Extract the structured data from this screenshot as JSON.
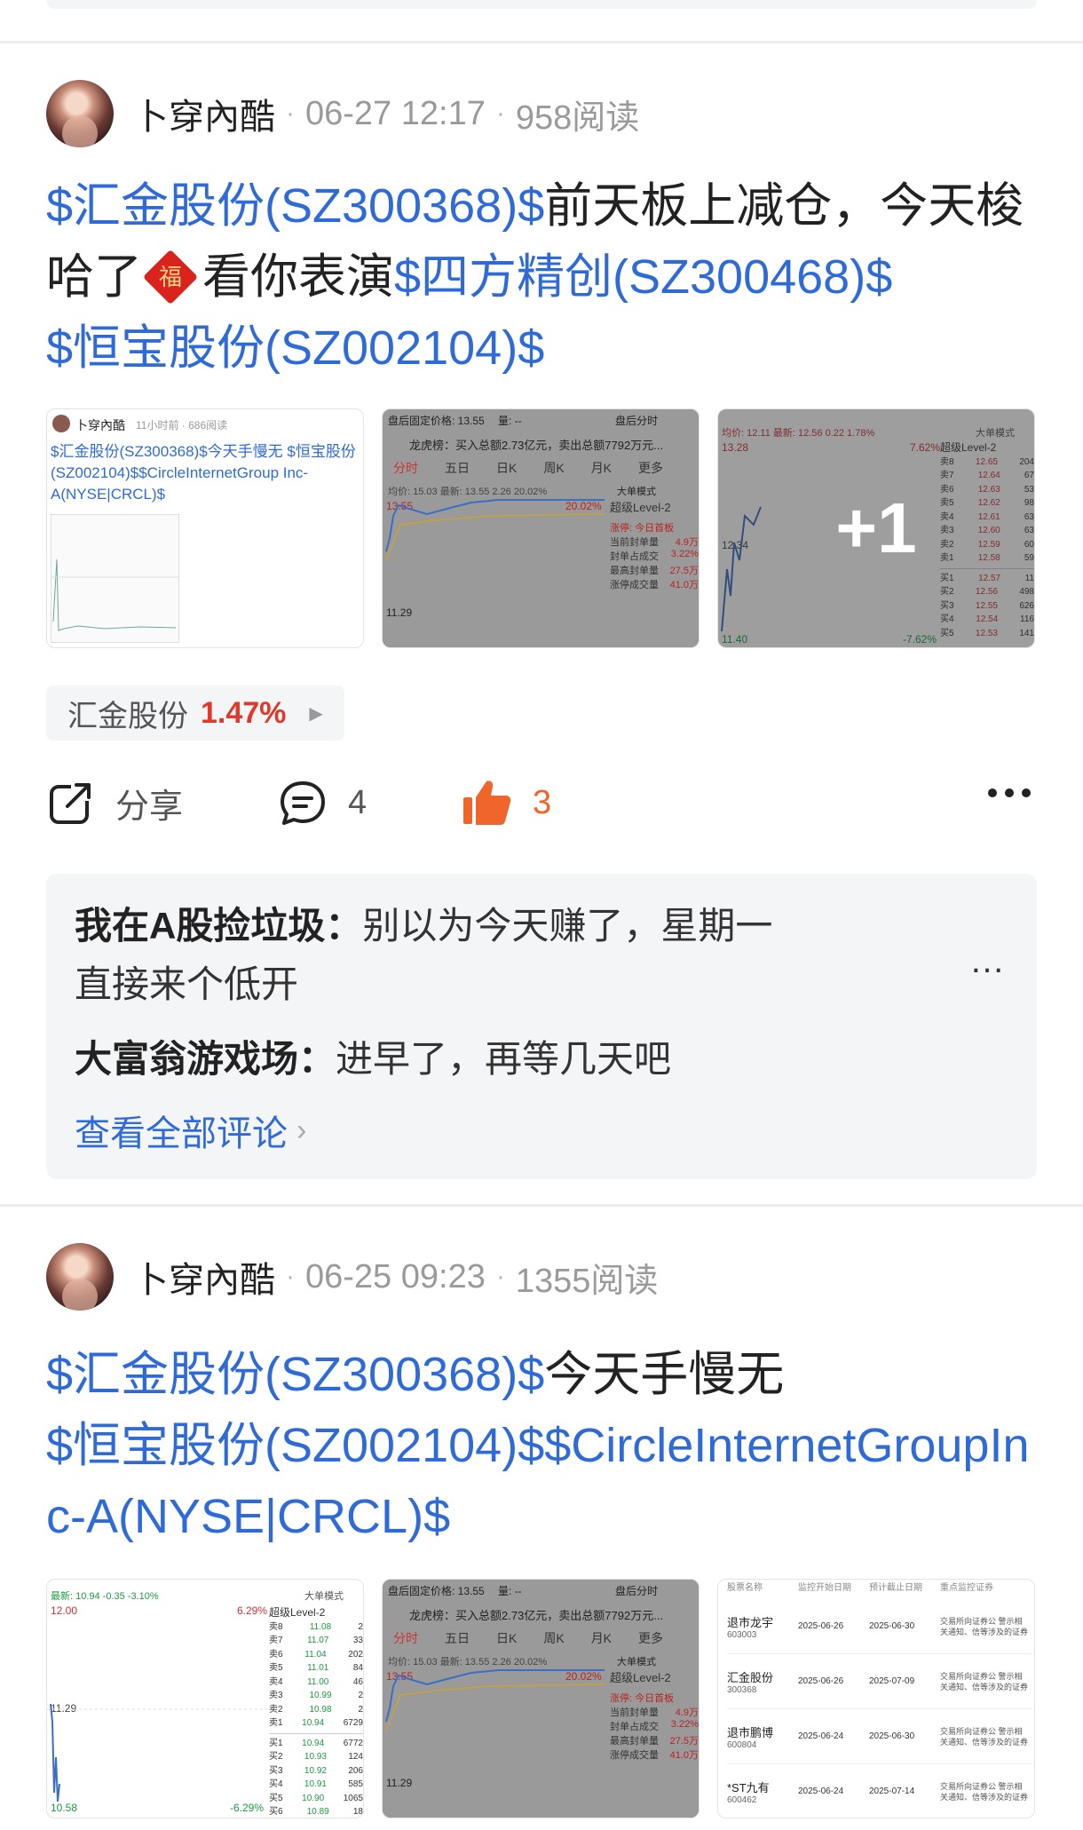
{
  "posts": [
    {
      "author": "卜穿內酷",
      "time": "06-27 12:17",
      "reads": "958阅读",
      "content": [
        {
          "type": "tag",
          "text": "$汇金股份(SZ300368)$"
        },
        {
          "type": "text",
          "text": "前天板上减仓，今天梭哈了"
        },
        {
          "type": "emoji",
          "icon": "fu-icon",
          "text": "福"
        },
        {
          "type": "text",
          "text": "看你表演"
        },
        {
          "type": "tag",
          "text": "$四方精创(SZ300468)$"
        },
        {
          "type": "tag",
          "text": "$恒宝股份(SZ002104)$"
        }
      ],
      "thumb1": {
        "author": "卜穿內酷",
        "meta": "11小时前 · 686阅读",
        "text": "$汇金股份(SZ300368)$今天手慢无 $恒宝股份(SZ002104)$$CircleInternetGroup Inc-A(NYSE|CRCL)$"
      },
      "thumb2": {
        "top_left": "盘后固定价格: 13.55",
        "top_mid": "量: --",
        "top_right": "盘后分时",
        "dragon": "龙虎榜：买入总额2.73亿元，卖出总额7792万元...",
        "tabs": [
          "分时",
          "五日",
          "日K",
          "周K",
          "月K",
          "更多"
        ],
        "mode": "大单模式",
        "price_row": "均价: 15.03 最新: 13.55 2.26 20.02%",
        "y_top": "13.55",
        "y_bottom": "11.29",
        "pct": "20.02%",
        "level": "超级Level-2",
        "limit": "涨停: 今日首板",
        "stats": [
          [
            "当前封单量",
            "4.9万"
          ],
          [
            "封单占成交",
            "3.22%"
          ],
          [
            "最高封单量",
            "27.5万"
          ],
          [
            "涨停成交量",
            "41.0万"
          ]
        ]
      },
      "thumb3": {
        "plus": "+1",
        "price_row": "均价: 12.11 最新: 12.56 0.22 1.78%",
        "mode": "大单模式",
        "y_top": "13.28",
        "y_mid": "12.34",
        "y_bottom": "11.40",
        "pct_top": "7.62%",
        "pct_bottom": "-7.62%",
        "level": "超级Level-2",
        "sells": [
          [
            "卖8",
            "12.65",
            "204"
          ],
          [
            "卖7",
            "12.64",
            "67"
          ],
          [
            "卖6",
            "12.63",
            "53"
          ],
          [
            "卖5",
            "12.62",
            "98"
          ],
          [
            "卖4",
            "12.61",
            "63"
          ],
          [
            "卖3",
            "12.60",
            "63"
          ],
          [
            "卖2",
            "12.59",
            "60"
          ],
          [
            "卖1",
            "12.58",
            "59"
          ]
        ],
        "buys": [
          [
            "买1",
            "12.57",
            "11"
          ],
          [
            "买2",
            "12.56",
            "498"
          ],
          [
            "买3",
            "12.55",
            "626"
          ],
          [
            "买4",
            "12.54",
            "116"
          ],
          [
            "买5",
            "12.53",
            "141"
          ]
        ]
      },
      "stock_chip": {
        "name": "汇金股份",
        "pct": "1.47%"
      },
      "actions": {
        "share": "分享",
        "comments": "4",
        "likes": "3"
      },
      "comments": [
        {
          "name": "我在A股捡垃圾：",
          "text": "别以为今天赚了，星期一直接来个低开"
        },
        {
          "name": "大富翁游戏场：",
          "text": "进早了，再等几天吧"
        }
      ],
      "view_all": "查看全部评论"
    },
    {
      "author": "卜穿內酷",
      "time": "06-25 09:23",
      "reads": "1355阅读",
      "content": [
        {
          "type": "tag",
          "text": "$汇金股份(SZ300368)$"
        },
        {
          "type": "text",
          "text": "今天手慢无"
        },
        {
          "type": "tag",
          "text": "$恒宝股份(SZ002104)$$CircleInternetGroupInc-A(NYSE|CRCL)$"
        }
      ],
      "thumb1": {
        "price_row": "最新: 10.94 -0.35 -3.10%",
        "mode": "大单模式",
        "y_top": "12.00",
        "y_mid": "11.29",
        "y_bottom": "10.58",
        "pct_top": "6.29%",
        "pct_bottom": "-6.29%",
        "level": "超级Level-2",
        "sells": [
          [
            "卖8",
            "11.08",
            "2"
          ],
          [
            "卖7",
            "11.07",
            "33"
          ],
          [
            "卖6",
            "11.04",
            "202"
          ],
          [
            "卖5",
            "11.01",
            "84"
          ],
          [
            "卖4",
            "11.00",
            "46"
          ],
          [
            "卖3",
            "10.99",
            "2"
          ],
          [
            "卖2",
            "10.98",
            "2"
          ],
          [
            "卖1",
            "10.94",
            "6729"
          ]
        ],
        "buys": [
          [
            "买1",
            "10.94",
            "6772"
          ],
          [
            "买2",
            "10.93",
            "124"
          ],
          [
            "买3",
            "10.92",
            "206"
          ],
          [
            "买4",
            "10.91",
            "585"
          ],
          [
            "买5",
            "10.90",
            "1065"
          ],
          [
            "买6",
            "10.89",
            "18"
          ]
        ]
      },
      "thumb3": {
        "headers": [
          "股票名称",
          "监控开始日期",
          "预计截止日期",
          "重点监控证券"
        ],
        "rows": [
          {
            "name": "退市龙宇",
            "code": "603003",
            "start": "2025-06-26",
            "end": "2025-06-30",
            "note": "交易所向证券公 警示相关通知、信等涉及的证券"
          },
          {
            "name": "汇金股份",
            "code": "300368",
            "start": "2025-06-26",
            "end": "2025-07-09",
            "note": "交易所向证券公 警示相关通知、信等涉及的证券"
          },
          {
            "name": "退市鹏博",
            "code": "600804",
            "start": "2025-06-24",
            "end": "2025-06-30",
            "note": "交易所向证券公 警示相关通知、信等涉及的证券"
          },
          {
            "name": "*ST九有",
            "code": "600462",
            "start": "2025-06-24",
            "end": "2025-07-14",
            "note": "交易所向证券公 警示相关通知、信等涉及的证券"
          }
        ]
      }
    }
  ],
  "colors": {
    "link": "#2f6bd8",
    "up": "#e0392b",
    "like": "#f0652a",
    "down": "#1a9c3e"
  }
}
